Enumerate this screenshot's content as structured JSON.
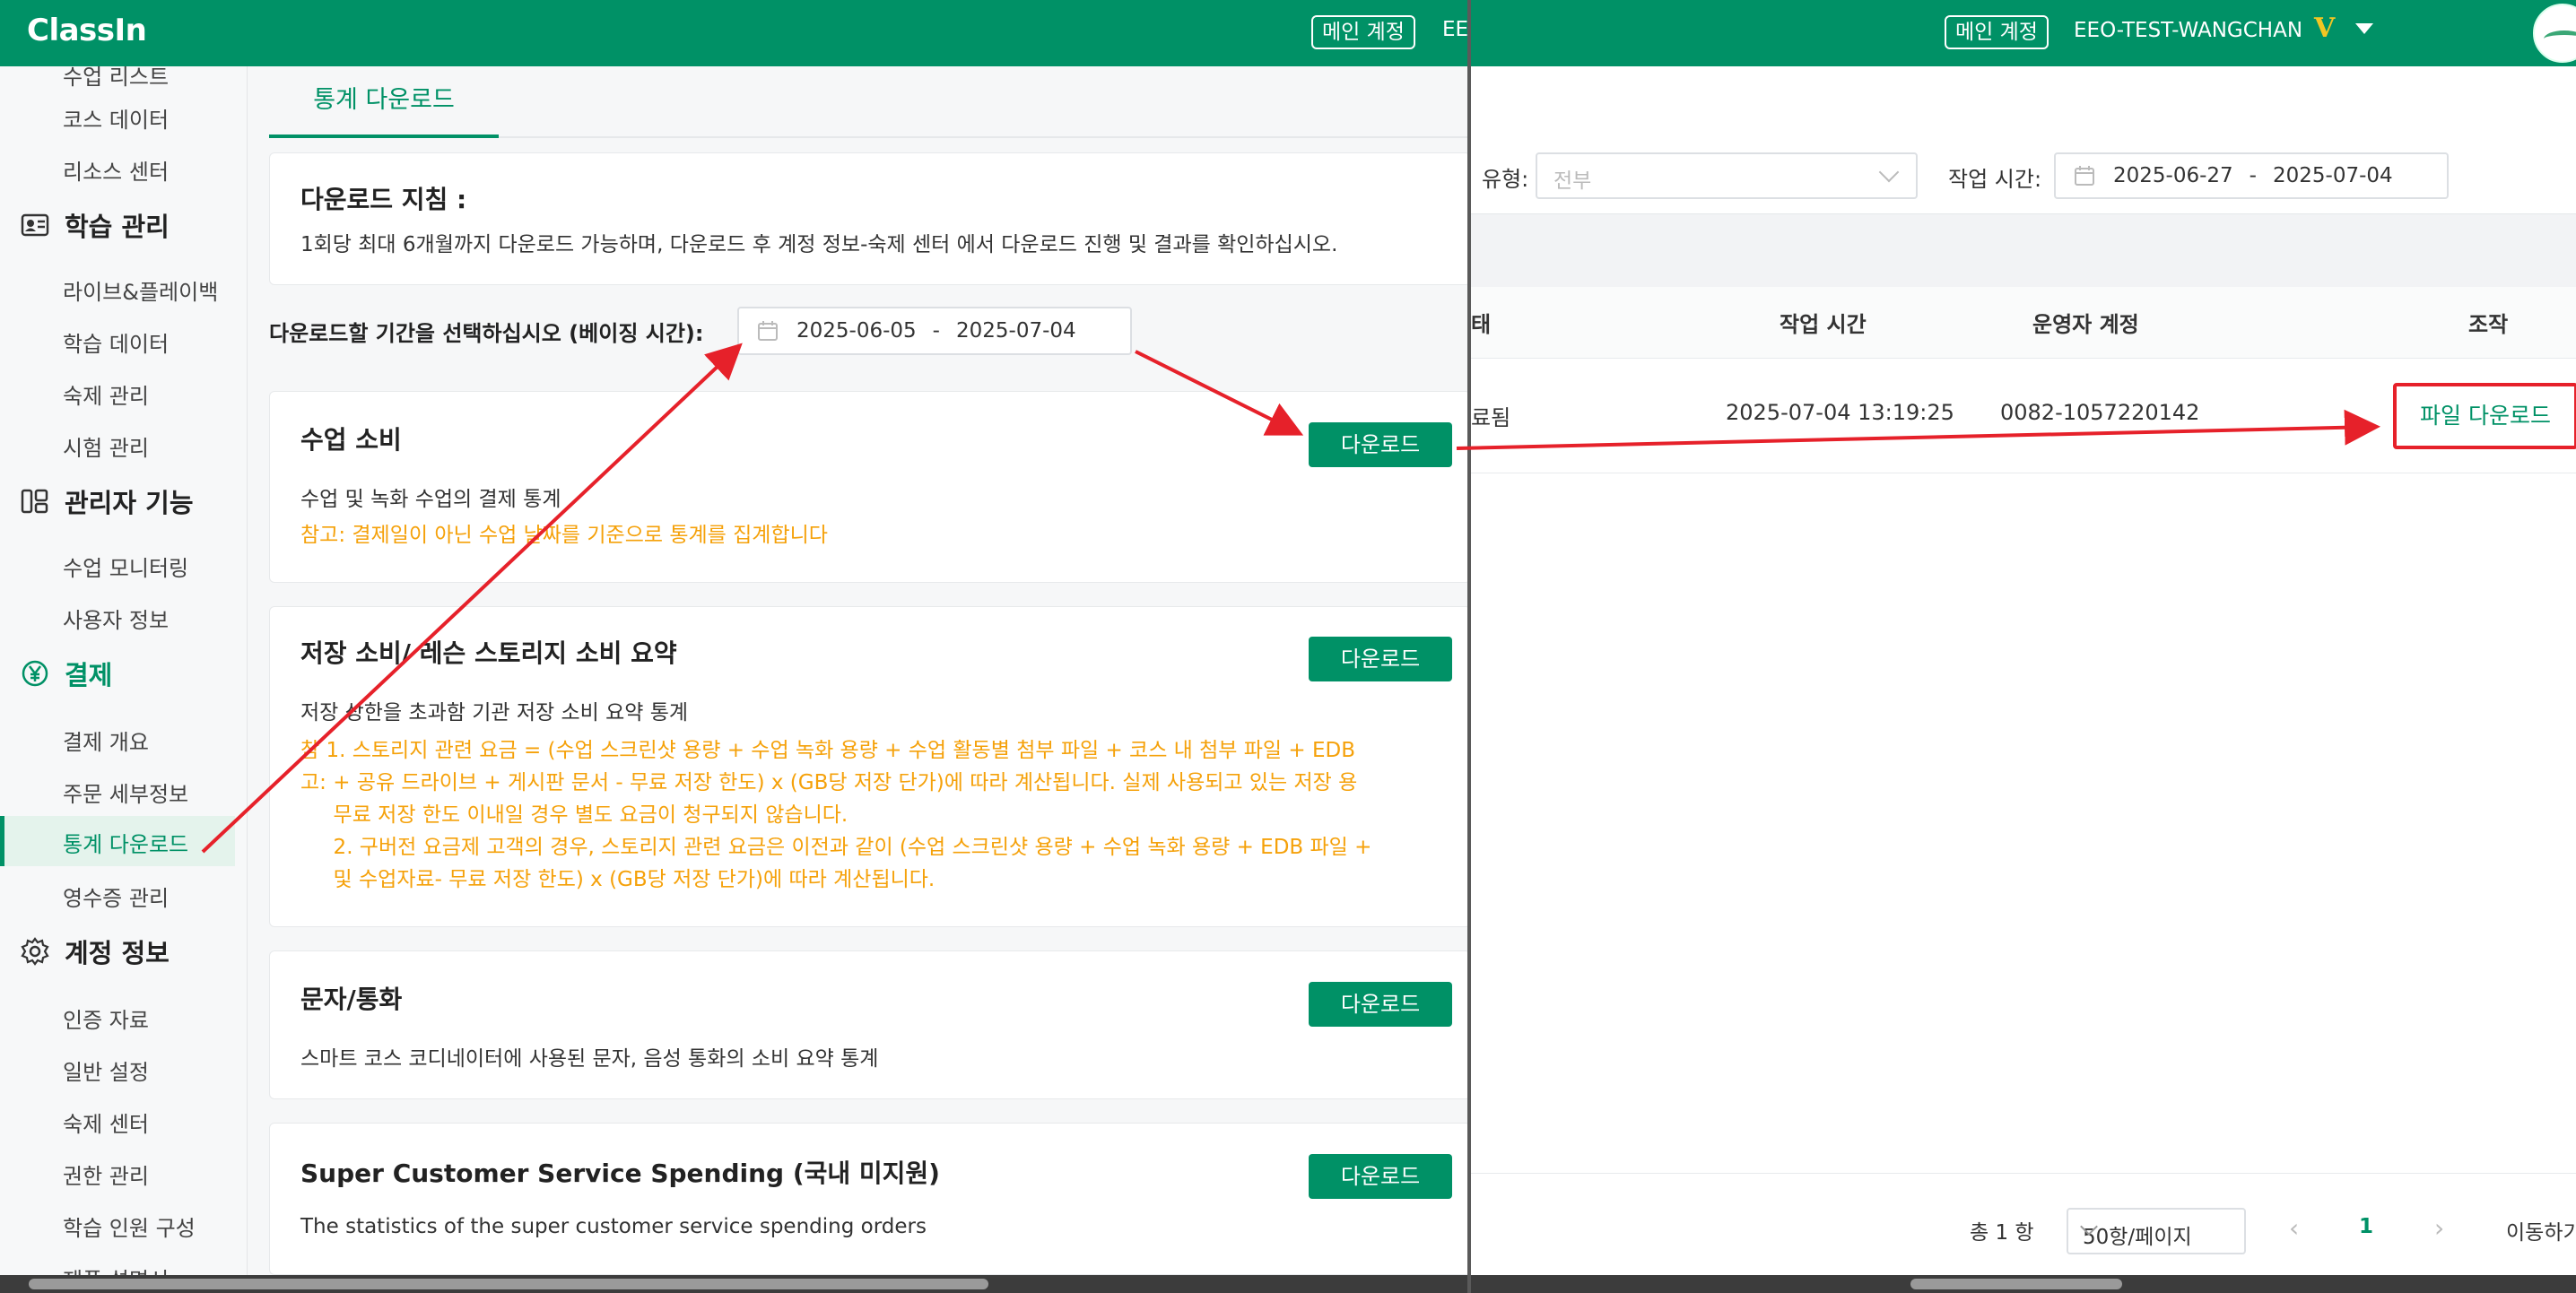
{
  "left": {
    "logo": "ClassIn",
    "main_account": "메인 계정",
    "account_fragment": "EE(",
    "sidebar": {
      "cut_item": "수업 리스트",
      "items_a": [
        "코스 데이터",
        "리소스 센터"
      ],
      "section_learning": "학습 관리",
      "items_learning": [
        "라이브&플레이백",
        "학습 데이터",
        "숙제 관리",
        "시험 관리"
      ],
      "section_admin": "관리자 기능",
      "items_admin": [
        "수업 모니터링",
        "사용자 정보"
      ],
      "section_payment": "결제",
      "items_payment": [
        "결제 개요",
        "주문 세부정보"
      ],
      "active_item": "통계 다운로드",
      "item_receipt": "영수증 관리",
      "section_account": "계정 정보",
      "items_account": [
        "인증 자료",
        "일반 설정",
        "숙제 센터",
        "권한 관리",
        "학습 인원 구성",
        "제품 설명서"
      ]
    },
    "tab_label": "통계 다운로드",
    "guide": {
      "title": "다운로드 지침 :",
      "text": "1회당 최대 6개월까지 다운로드 가능하며, 다운로드 후 계정 정보-숙제 센터 에서 다운로드 진행 및 결과를 확인하십시오."
    },
    "period_label": "다운로드할 기간을 선택하십시오 (베이징 시간):",
    "period_start": "2025-06-05",
    "period_sep": "-",
    "period_end": "2025-07-04",
    "download_label": "다운로드",
    "cards": {
      "class": {
        "title": "수업 소비",
        "desc": "수업 및 녹화 수업의 결제 통계",
        "note": "참고: 결제일이 아닌 수업 날짜를 기준으로 통계를 집계합니다"
      },
      "storage": {
        "title": "저장 소비/ 레슨 스토리지 소비 요약",
        "desc": "저장 상한을 초과함 기관 저장 소비 요약 통계",
        "note_1a": "참  1. 스토리지 관련 요금 = (수업 스크린샷 용량 + 수업 녹화 용량 + 수업 활동별 첨부 파일 + 코스 내 첨부 파일 + EDB",
        "note_1b": "고: + 공유 드라이브 + 게시판 문서 - 무료 저장 한도) x (GB당 저장 단가)에 따라 계산됩니다. 실제 사용되고 있는 저장 용",
        "note_1c": "     무료 저장 한도 이내일 경우 별도 요금이 청구되지 않습니다.",
        "note_2a": "     2. 구버전 요금제 고객의 경우, 스토리지 관련 요금은 이전과 같이 (수업 스크린샷 용량 + 수업 녹화 용량 + EDB 파일 +",
        "note_2b": "     및 수업자료- 무료 저장 한도) x (GB당 저장 단가)에 따라 계산됩니다."
      },
      "sms": {
        "title": "문자/통화",
        "desc": "스마트 코스 코디네이터에 사용된 문자, 음성 통화의 소비 요약 통계"
      },
      "super": {
        "title": "Super Customer Service Spending (국내 미지원)",
        "desc": "The statistics of the super customer service spending orders"
      }
    }
  },
  "right": {
    "main_account": "메인 계정",
    "account_name": "EEO-TEST-WANGCHAN",
    "vip_badge": "V",
    "filter_type_label": "유형:",
    "filter_type_placeholder": "전부",
    "filter_time_label": "작업 시간:",
    "filter_time_start": "2025-06-27",
    "filter_time_sep": "-",
    "filter_time_end": "2025-07-04",
    "columns": [
      "태",
      "작업 시간",
      "운영자 계정",
      "조작"
    ],
    "row": {
      "status": "료됨",
      "time": "2025-07-04 13:19:25",
      "operator": "0082-1057220142",
      "action": "파일 다운로드"
    },
    "pagination": {
      "total": "총 1 항",
      "page_size": "50항/페이지",
      "prev": "‹",
      "page": "1",
      "next": "›",
      "goto": "이동하기"
    }
  },
  "colors": {
    "brand_green": "#009166",
    "warning_orange": "#f5a10a",
    "annotation_red": "#e6212a"
  }
}
